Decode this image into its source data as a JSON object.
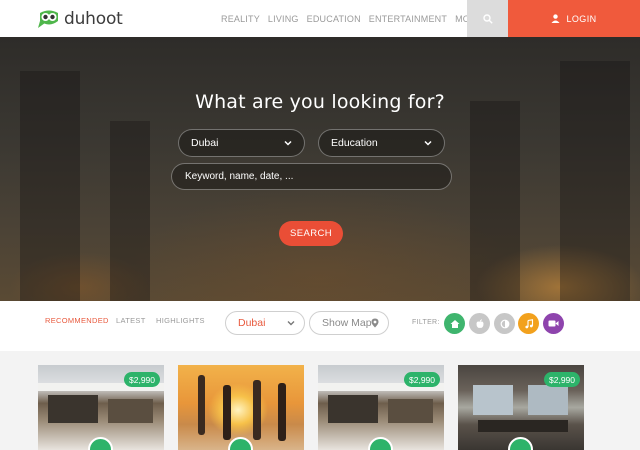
{
  "brand": {
    "name": "duhoot"
  },
  "nav": {
    "items": [
      "REALITY",
      "LIVING",
      "EDUCATION",
      "ENTERTAINMENT",
      "MOBILITY"
    ],
    "search_icon": "search-icon",
    "login_label": "LOGIN"
  },
  "hero": {
    "title": "What are you looking for?",
    "location_value": "Dubai",
    "category_value": "Education",
    "keyword_placeholder": "Keyword, name, date, ...",
    "search_label": "SEARCH"
  },
  "filterbar": {
    "tabs": [
      "RECOMMENDED",
      "LATEST",
      "HIGHLIGHTS"
    ],
    "active_tab": "RECOMMENDED",
    "city_value": "Dubai",
    "map_label": "Show Map",
    "filter_label": "FILTER:",
    "filters": [
      {
        "icon": "home-icon",
        "color": "#3fb56e"
      },
      {
        "icon": "apple-icon",
        "color": "#c7c7c7"
      },
      {
        "icon": "contrast-icon",
        "color": "#c7c7c7"
      },
      {
        "icon": "music-icon",
        "color": "#f2a11d"
      },
      {
        "icon": "video-icon",
        "color": "#8e44ad"
      }
    ]
  },
  "cards": [
    {
      "price": "$2,990",
      "image": "villa-exterior"
    },
    {
      "image": "beach-party"
    },
    {
      "price": "$2,990",
      "image": "villa-exterior"
    },
    {
      "price": "$2,990",
      "image": "apartment-interior"
    }
  ],
  "colors": {
    "accent": "#f05a3c",
    "green": "#2db36a"
  }
}
